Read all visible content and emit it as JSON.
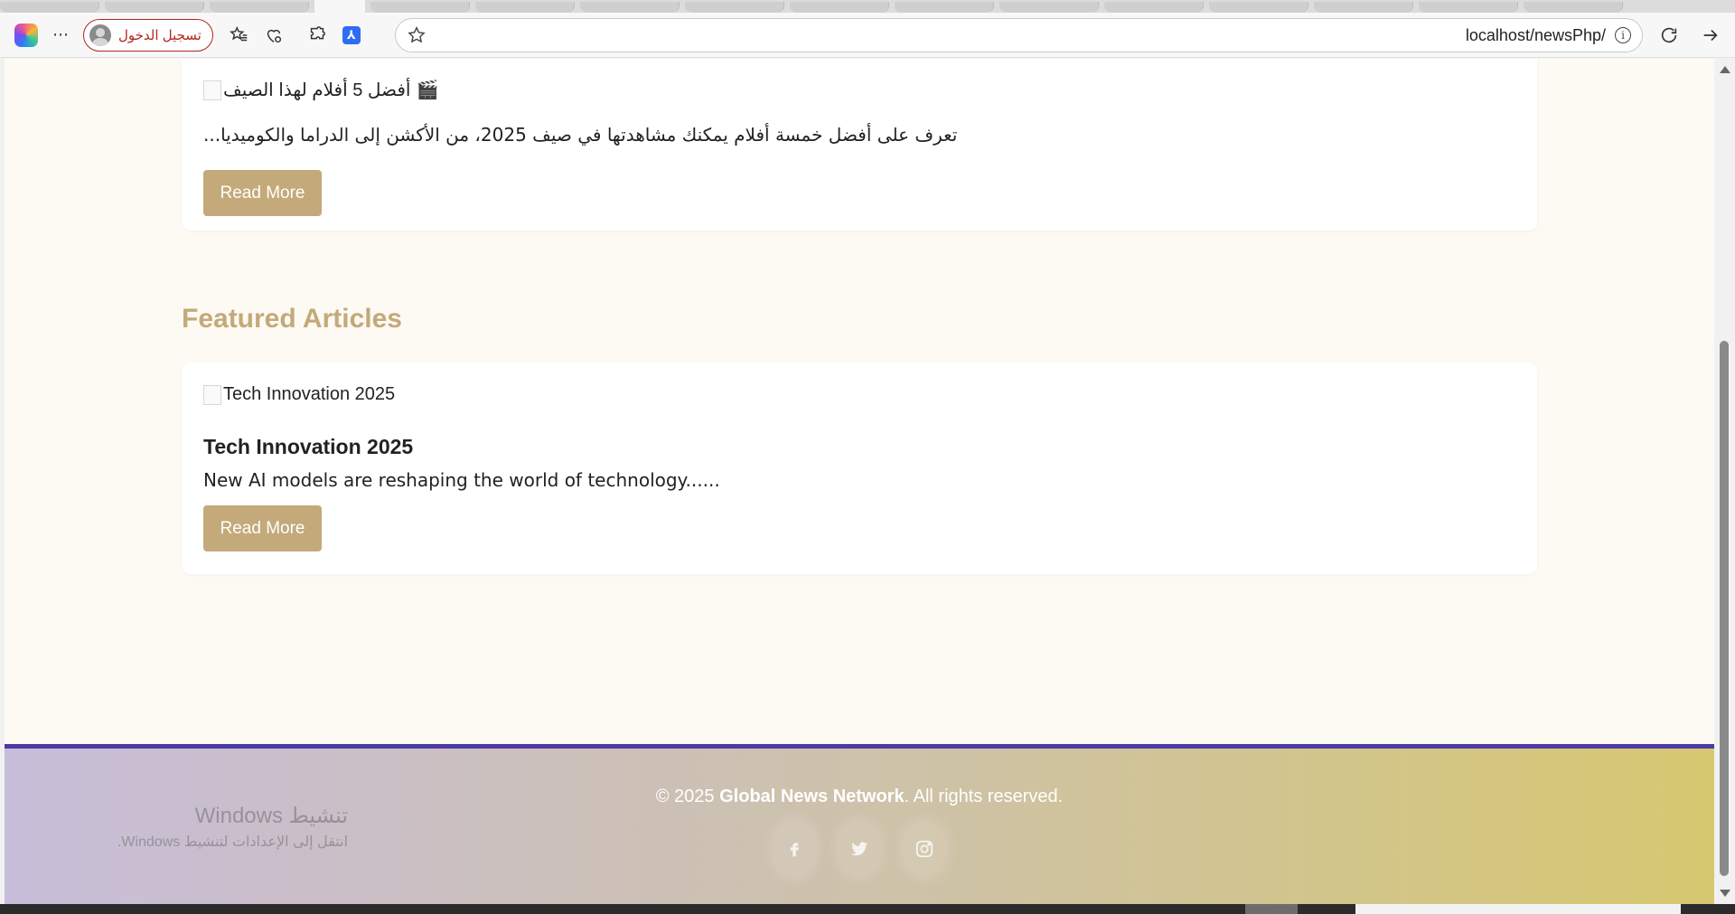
{
  "browser": {
    "address": "localhost/newsPhp/",
    "signin_label": "تسجيل الدخول"
  },
  "articles_top": {
    "image_alt": "أفضل 5 أفلام لهذا الصيف",
    "clapper": "🎬",
    "description": "تعرف على أفضل خمسة أفلام يمكنك مشاهدتها في صيف 2025، من الأكشن إلى الدراما والكوميديا...",
    "read_more": "Read More"
  },
  "featured": {
    "section_title": "Featured Articles",
    "items": [
      {
        "image_alt": "Tech Innovation 2025",
        "title": "Tech Innovation 2025",
        "description": "New AI models are reshaping the world of technology......",
        "read_more": "Read More"
      }
    ]
  },
  "footer": {
    "copyright_prefix": "© 2025 ",
    "brand": "Global News Network",
    "copyright_suffix": ". All rights reserved.",
    "socials": [
      "facebook-icon",
      "twitter-icon",
      "instagram-icon"
    ]
  },
  "watermark": {
    "title": "تنشيط Windows",
    "subtitle": "انتقل إلى الإعدادات لتنشيط Windows."
  },
  "colors": {
    "accent": "#c4a97a",
    "footer_border": "#4c3aa5",
    "page_bg": "#fcfaf3"
  }
}
